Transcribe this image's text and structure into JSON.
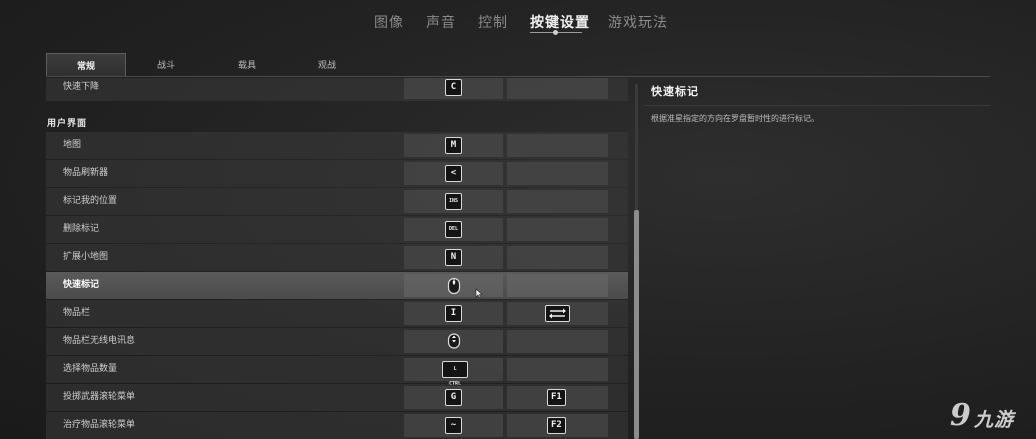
{
  "top_tabs": [
    {
      "label": "图像"
    },
    {
      "label": "声音"
    },
    {
      "label": "控制"
    },
    {
      "label": "按键设置"
    },
    {
      "label": "游戏玩法"
    }
  ],
  "active_top_tab": "按键设置",
  "sub_tabs": [
    {
      "label": "常规"
    },
    {
      "label": "战斗"
    },
    {
      "label": "载具"
    },
    {
      "label": "观战"
    }
  ],
  "active_sub_tab": "常规",
  "partial_row": {
    "label": "快速下降",
    "key1": "C",
    "key2": ""
  },
  "section_header": "用户界面",
  "rows": [
    {
      "label": "地图",
      "key1": "M",
      "key2": ""
    },
    {
      "label": "物品刷新器",
      "key1": "<",
      "key2": ""
    },
    {
      "label": "标记我的位置",
      "key1": "INS",
      "key2": ""
    },
    {
      "label": "删除标记",
      "key1": "DEL",
      "key2": ""
    },
    {
      "label": "扩展小地图",
      "key1": "N",
      "key2": ""
    },
    {
      "label": "快速标记",
      "key1": "mouse-middle-icon",
      "key2": ""
    },
    {
      "label": "物品栏",
      "key1": "I",
      "key2": "tab-icon"
    },
    {
      "label": "物品栏无线电讯息",
      "key1": "mouse-wheel-icon",
      "key2": ""
    },
    {
      "label": "选择物品数量",
      "key1": "L CTRL",
      "key2": ""
    },
    {
      "label": "投掷武器滚轮菜单",
      "key1": "G",
      "key2": "F1"
    },
    {
      "label": "治疗物品滚轮菜单",
      "key1": "~",
      "key2": "F2"
    }
  ],
  "selected_row": "快速标记",
  "detail": {
    "title": "快速标记",
    "description": "根据准星指定的方向在罗盘暂时性的进行标记。"
  },
  "watermark": {
    "logo": "9",
    "text": "九游"
  }
}
